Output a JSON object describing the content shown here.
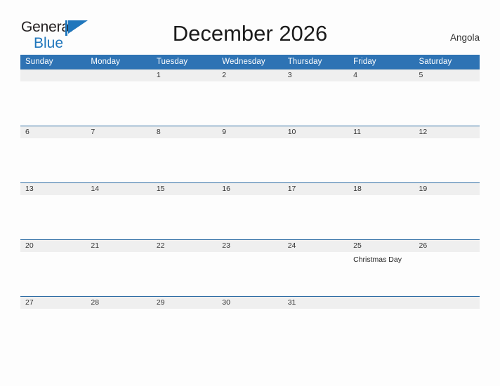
{
  "brand": {
    "line1": "General",
    "line2": "Blue",
    "flag_icon": "blue-flag-triangle-icon",
    "accent_color": "#1f76bc"
  },
  "header": {
    "title": "December 2026",
    "country": "Angola"
  },
  "theme": {
    "header_blue": "#2e73b4",
    "row_line_blue": "#2e6da4",
    "date_band_gray": "#efefef",
    "page_background": "#fdfdfd"
  },
  "calendar": {
    "weekday_headers": [
      "Sunday",
      "Monday",
      "Tuesday",
      "Wednesday",
      "Thursday",
      "Friday",
      "Saturday"
    ],
    "weeks": [
      [
        {
          "day": "",
          "events": []
        },
        {
          "day": "",
          "events": []
        },
        {
          "day": "1",
          "events": []
        },
        {
          "day": "2",
          "events": []
        },
        {
          "day": "3",
          "events": []
        },
        {
          "day": "4",
          "events": []
        },
        {
          "day": "5",
          "events": []
        }
      ],
      [
        {
          "day": "6",
          "events": []
        },
        {
          "day": "7",
          "events": []
        },
        {
          "day": "8",
          "events": []
        },
        {
          "day": "9",
          "events": []
        },
        {
          "day": "10",
          "events": []
        },
        {
          "day": "11",
          "events": []
        },
        {
          "day": "12",
          "events": []
        }
      ],
      [
        {
          "day": "13",
          "events": []
        },
        {
          "day": "14",
          "events": []
        },
        {
          "day": "15",
          "events": []
        },
        {
          "day": "16",
          "events": []
        },
        {
          "day": "17",
          "events": []
        },
        {
          "day": "18",
          "events": []
        },
        {
          "day": "19",
          "events": []
        }
      ],
      [
        {
          "day": "20",
          "events": []
        },
        {
          "day": "21",
          "events": []
        },
        {
          "day": "22",
          "events": []
        },
        {
          "day": "23",
          "events": []
        },
        {
          "day": "24",
          "events": []
        },
        {
          "day": "25",
          "events": [
            "Christmas Day"
          ]
        },
        {
          "day": "26",
          "events": []
        }
      ],
      [
        {
          "day": "27",
          "events": []
        },
        {
          "day": "28",
          "events": []
        },
        {
          "day": "29",
          "events": []
        },
        {
          "day": "30",
          "events": []
        },
        {
          "day": "31",
          "events": []
        },
        {
          "day": "",
          "events": []
        },
        {
          "day": "",
          "events": []
        }
      ]
    ]
  }
}
